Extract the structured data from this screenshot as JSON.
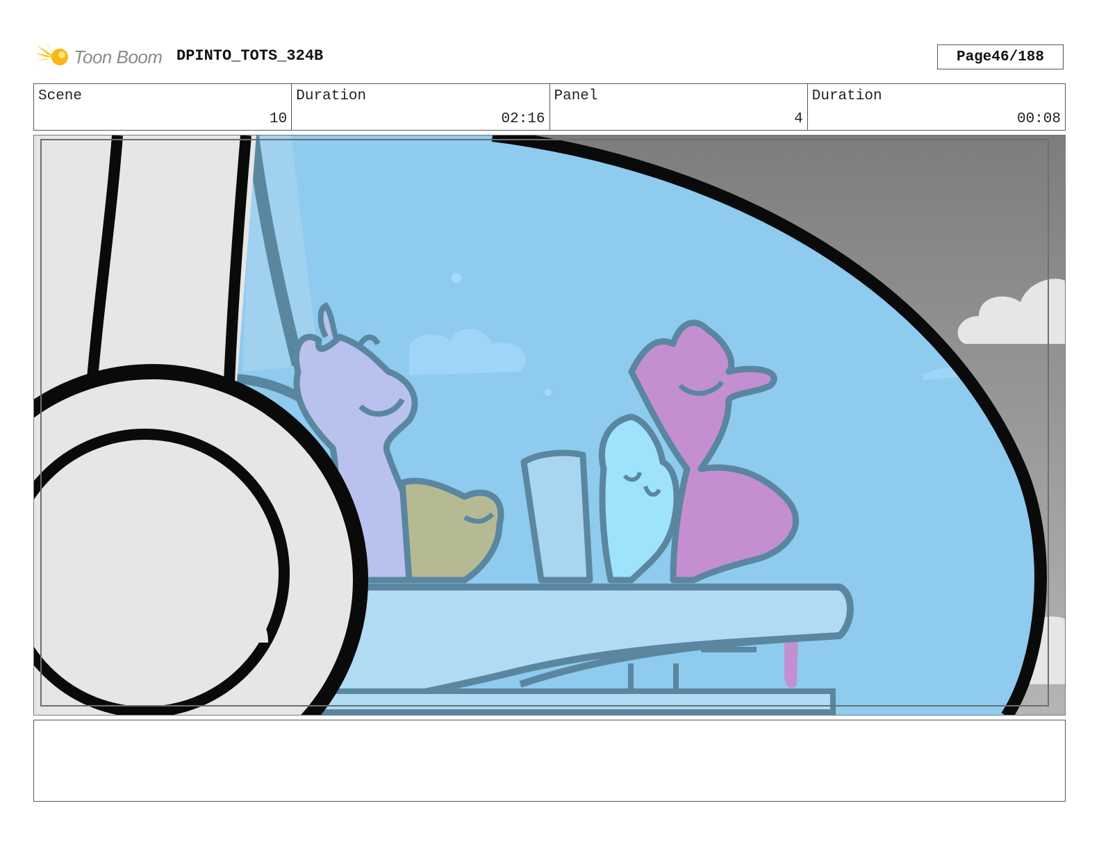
{
  "header": {
    "logo_text": "Toon Boom",
    "project_title": "DPINTO_TOTS_324B",
    "page_label": "Page",
    "page_number": "46/188"
  },
  "info": [
    {
      "label": "Scene",
      "value": "10"
    },
    {
      "label": "Duration",
      "value": "02:16"
    },
    {
      "label": "Panel",
      "value": "4"
    },
    {
      "label": "Duration",
      "value": "00:08"
    }
  ],
  "notes": {
    "text": ""
  },
  "colors": {
    "sky": "#8ecbef",
    "line": "#5a86a0",
    "char_purple": "#c48fd0",
    "char_lavender": "#b9c1ee",
    "char_cyan": "#9fe2fb",
    "outer_gray": "#8c8c8c",
    "logo_yellow": "#f7c21a"
  }
}
